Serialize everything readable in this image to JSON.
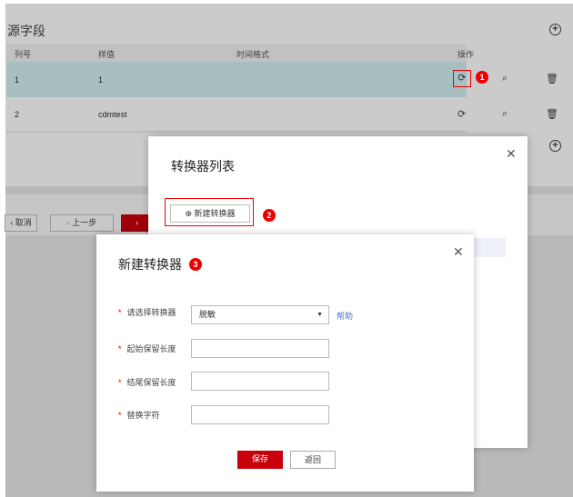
{
  "section_title": "源字段",
  "table": {
    "headers": [
      "列号",
      "样值",
      "时间格式",
      "操作"
    ],
    "rows": [
      {
        "col": "1",
        "sample": "1",
        "format": ""
      },
      {
        "col": "2",
        "sample": "cdmtest",
        "format": ""
      }
    ]
  },
  "footer": {
    "cancel": "取消",
    "prev": "上一步"
  },
  "dialog1": {
    "title": "转换器列表",
    "new_button": "新建转换器"
  },
  "dialog2": {
    "title": "新建转换器",
    "fields": [
      {
        "label": "请选择转换器",
        "value": "脱敏"
      },
      {
        "label": "起始保留长度",
        "value": ""
      },
      {
        "label": "结尾保留长度",
        "value": ""
      },
      {
        "label": "替换字符",
        "value": ""
      }
    ],
    "help": "帮助",
    "save": "保存",
    "back": "返回"
  },
  "badges": [
    "1",
    "2",
    "3"
  ],
  "colors": {
    "highlight_row": "#a8bfc1",
    "primary": "#c7000b",
    "annotation": "#e00000",
    "link": "#526ecc"
  }
}
